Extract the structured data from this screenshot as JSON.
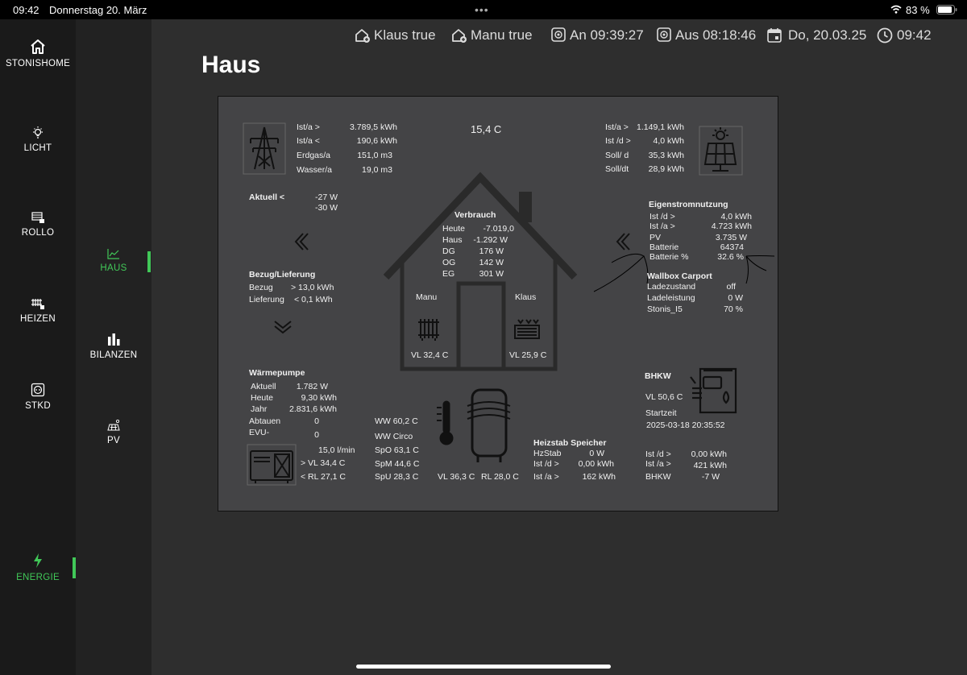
{
  "status": {
    "time": "09:42",
    "date": "Donnerstag 20. März",
    "battery": "83 %"
  },
  "nav": {
    "primary": [
      {
        "label": "STONISHOME",
        "icon": "home-icon"
      },
      {
        "label": "LICHT",
        "icon": "lightbulb-icon"
      },
      {
        "label": "ROLLO",
        "icon": "blinds-icon"
      },
      {
        "label": "HEIZEN",
        "icon": "radiator-icon"
      },
      {
        "label": "STKD",
        "icon": "socket-icon"
      },
      {
        "label": "ENERGIE",
        "icon": "lightning-icon"
      }
    ],
    "secondary": [
      {
        "label": "HAUS",
        "icon": "chart-line-icon"
      },
      {
        "label": "BILANZEN",
        "icon": "bar-chart-icon"
      },
      {
        "label": "PV",
        "icon": "solar-panel-icon"
      }
    ]
  },
  "topinfo": {
    "klaus": "Klaus true",
    "manu": "Manu true",
    "an": "An 09:39:27",
    "aus": "Aus 08:18:46",
    "date": "Do, 20.03.25",
    "time": "09:42"
  },
  "page": {
    "title": "Haus"
  },
  "panel": {
    "temperature": "15,4 C",
    "grid": {
      "rows": [
        {
          "label": "Ist/a >",
          "value": "3.789,5 kWh"
        },
        {
          "label": "Ist/a <",
          "value": "190,6 kWh"
        },
        {
          "label": "Erdgas/a",
          "value": "151,0 m3"
        },
        {
          "label": "Wasser/a",
          "value": "19,0 m3"
        }
      ]
    },
    "pv": {
      "rows": [
        {
          "label": "Ist/a >",
          "value": "1.149,1 kWh"
        },
        {
          "label": "Ist /d >",
          "value": "4,0 kWh"
        },
        {
          "label": "Soll/ d",
          "value": "35,3 kWh"
        },
        {
          "label": "Soll/dt",
          "value": "28,9 kWh"
        }
      ]
    },
    "aktuell": {
      "label": "Aktuell <",
      "v1": "-27 W",
      "v2": "-30 W"
    },
    "bezug": {
      "title": "Bezug/Lieferung",
      "bezug_label": "Bezug",
      "bezug_value": "> 13,0 kWh",
      "lief_label": "Lieferung",
      "lief_value": "< 0,1 kWh"
    },
    "verbrauch": {
      "title": "Verbrauch",
      "rows": [
        {
          "label": "Heute",
          "value": "-7.019,0"
        },
        {
          "label": "Haus",
          "value": "-1.292 W"
        },
        {
          "label": "DG",
          "value": "176 W"
        },
        {
          "label": "OG",
          "value": "142 W"
        },
        {
          "label": "EG",
          "value": "301 W"
        }
      ]
    },
    "rooms": {
      "manu": "Manu",
      "klaus": "Klaus",
      "vl_manu": "VL 32,4 C",
      "vl_klaus": "VL 25,9 C"
    },
    "eigen": {
      "title": "Eigenstromnutzung",
      "rows": [
        {
          "label": "Ist /d >",
          "value": "4,0 kWh"
        },
        {
          "label": "Ist /a >",
          "value": "4.723 kWh"
        },
        {
          "label": "PV",
          "value": "3.735 W"
        },
        {
          "label": "Batterie",
          "value": "64374"
        },
        {
          "label": "Batterie %",
          "value": "32.6 %"
        }
      ]
    },
    "wallbox": {
      "title": "Wallbox Carport",
      "rows": [
        {
          "label": "Ladezustand",
          "value": "off"
        },
        {
          "label": "Ladeleistung",
          "value": "0 W"
        },
        {
          "label": "Stonis_I5",
          "value": "70 %"
        }
      ]
    },
    "waermepumpe": {
      "title": "Wärmepumpe",
      "rows": [
        {
          "label": "Aktuell",
          "value": "1.782 W"
        },
        {
          "label": "Heute",
          "value": "9,30 kWh"
        },
        {
          "label": "Jahr",
          "value": "2.831,6 kWh"
        },
        {
          "label": "Abtauen",
          "value": "0"
        },
        {
          "label": "EVU-",
          "value": "0"
        }
      ],
      "flow": "15,0 l/min",
      "vl": "> VL 34,4 C",
      "rl": "< RL 27,1 C"
    },
    "speicher": {
      "ww": "WW 60,2 C",
      "circo": "WW Circo",
      "spo": "SpO 63,1 C",
      "spm": "SpM 44,6 C",
      "spu": "SpU 28,3 C",
      "vl": "VL 36,3 C",
      "rl": "RL 28,0 C"
    },
    "heizstab": {
      "title": "Heizstab Speicher",
      "rows": [
        {
          "label": "HzStab",
          "value": "0 W"
        },
        {
          "label": "Ist /d >",
          "value": "0,00 kWh"
        },
        {
          "label": "Ist /a >",
          "value": "162 kWh"
        }
      ]
    },
    "bhkw": {
      "title": "BHKW",
      "vl": "VL 50,6 C",
      "startzeit_label": "Startzeit",
      "startzeit": "2025-03-18 20:35:52",
      "rows": [
        {
          "label": "Ist /d >",
          "value": "0,00 kWh"
        },
        {
          "label": "Ist /a >",
          "value": "421 kWh"
        },
        {
          "label": "BHKW",
          "value": "-7 W"
        }
      ]
    }
  }
}
